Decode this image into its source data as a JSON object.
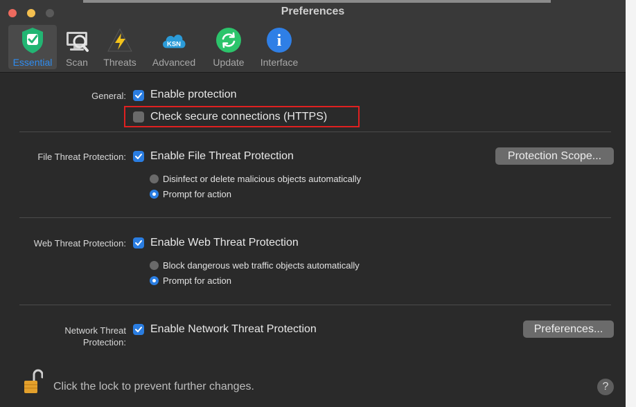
{
  "window": {
    "title": "Preferences"
  },
  "tabs": [
    {
      "label": "Essential",
      "icon": "shield-check-icon",
      "active": true
    },
    {
      "label": "Scan",
      "icon": "scan-icon"
    },
    {
      "label": "Threats",
      "icon": "threats-bolt-icon"
    },
    {
      "label": "Advanced",
      "icon": "ksn-cloud-icon",
      "icon_text": "KSN"
    },
    {
      "label": "Update",
      "icon": "update-icon"
    },
    {
      "label": "Interface",
      "icon": "info-icon",
      "icon_text": "i"
    }
  ],
  "general": {
    "label": "General:",
    "enable_protection": {
      "text": "Enable protection",
      "checked": true
    },
    "check_https": {
      "text": "Check secure connections (HTTPS)",
      "checked": false
    }
  },
  "file_threat": {
    "label": "File Threat Protection:",
    "enable": {
      "text": "Enable File Threat Protection",
      "checked": true
    },
    "options": [
      "Disinfect or delete malicious objects automatically",
      "Prompt for action"
    ],
    "selected_option": "Prompt for action",
    "scope_button": "Protection Scope..."
  },
  "web_threat": {
    "label": "Web Threat Protection:",
    "enable": {
      "text": "Enable Web Threat Protection",
      "checked": true
    },
    "options": [
      "Block dangerous web traffic objects automatically",
      "Prompt for action"
    ],
    "selected_option": "Prompt for action"
  },
  "network_threat": {
    "label_line1": "Network Threat",
    "label_line2": "Protection:",
    "enable": {
      "text": "Enable Network Threat Protection",
      "checked": true
    },
    "preferences_button": "Preferences..."
  },
  "footer": {
    "lock_text": "Click the lock to prevent further changes.",
    "help": "?"
  },
  "colors": {
    "accent": "#2a7de1",
    "highlight": "#e02020",
    "active_tab_label": "#2f8cf0",
    "background": "#2a2a2a"
  }
}
